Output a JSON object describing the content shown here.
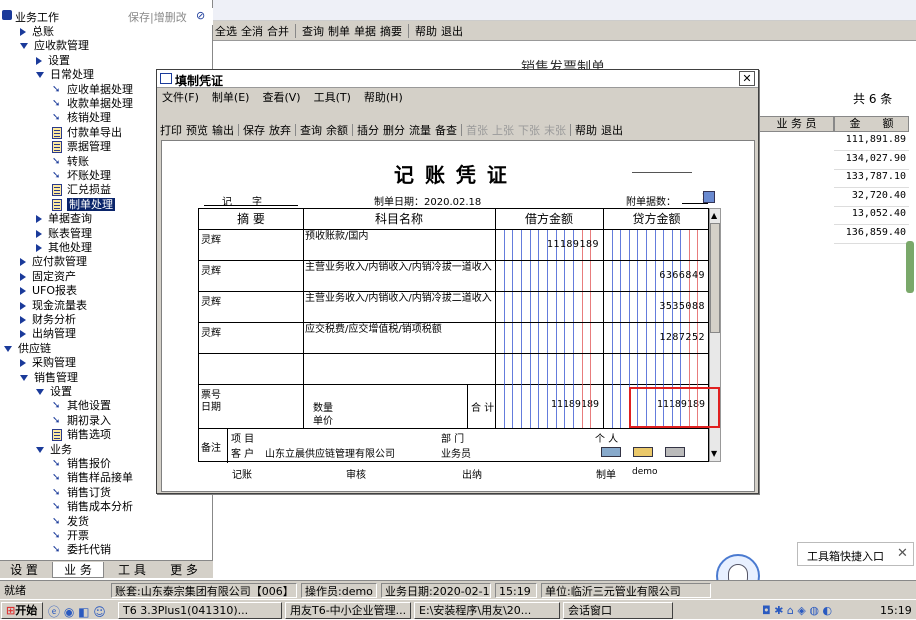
{
  "left_panel": {
    "title": "业务工作",
    "actions": "保存|增删改",
    "items": [
      {
        "label": "总账",
        "level": 1,
        "kind": "closed"
      },
      {
        "label": "应收款管理",
        "level": 1,
        "kind": "open"
      },
      {
        "label": "设置",
        "level": 2,
        "kind": "closed"
      },
      {
        "label": "日常处理",
        "level": 2,
        "kind": "open"
      },
      {
        "label": "应收单据处理",
        "level": 3,
        "kind": "arrow"
      },
      {
        "label": "收款单据处理",
        "level": 3,
        "kind": "arrow"
      },
      {
        "label": "核销处理",
        "level": 3,
        "kind": "arrow"
      },
      {
        "label": "付款单导出",
        "level": 3,
        "kind": "doc"
      },
      {
        "label": "票据管理",
        "level": 3,
        "kind": "doc"
      },
      {
        "label": "转账",
        "level": 3,
        "kind": "arrow"
      },
      {
        "label": "坏账处理",
        "level": 3,
        "kind": "arrow"
      },
      {
        "label": "汇兑损益",
        "level": 3,
        "kind": "doc"
      },
      {
        "label": "制单处理",
        "level": 3,
        "kind": "doc",
        "selected": true
      },
      {
        "label": "单据查询",
        "level": 2,
        "kind": "closed"
      },
      {
        "label": "账表管理",
        "level": 2,
        "kind": "closed"
      },
      {
        "label": "其他处理",
        "level": 2,
        "kind": "closed"
      },
      {
        "label": "应付款管理",
        "level": 1,
        "kind": "closed"
      },
      {
        "label": "固定资产",
        "level": 1,
        "kind": "closed"
      },
      {
        "label": "UFO报表",
        "level": 1,
        "kind": "closed"
      },
      {
        "label": "现金流量表",
        "level": 1,
        "kind": "closed"
      },
      {
        "label": "财务分析",
        "level": 1,
        "kind": "closed"
      },
      {
        "label": "出纳管理",
        "level": 1,
        "kind": "closed"
      },
      {
        "label": "供应链",
        "level": 0,
        "kind": "open"
      },
      {
        "label": "采购管理",
        "level": 1,
        "kind": "closed"
      },
      {
        "label": "销售管理",
        "level": 1,
        "kind": "open"
      },
      {
        "label": "设置",
        "level": 2,
        "kind": "open"
      },
      {
        "label": "其他设置",
        "level": 3,
        "kind": "arrow"
      },
      {
        "label": "期初录入",
        "level": 3,
        "kind": "arrow"
      },
      {
        "label": "销售选项",
        "level": 3,
        "kind": "doc"
      },
      {
        "label": "业务",
        "level": 2,
        "kind": "open"
      },
      {
        "label": "销售报价",
        "level": 3,
        "kind": "arrow"
      },
      {
        "label": "销售样品接单",
        "level": 3,
        "kind": "arrow"
      },
      {
        "label": "销售订货",
        "level": 3,
        "kind": "arrow"
      },
      {
        "label": "销售成本分析",
        "level": 3,
        "kind": "arrow"
      },
      {
        "label": "发货",
        "level": 3,
        "kind": "arrow"
      },
      {
        "label": "开票",
        "level": 3,
        "kind": "arrow"
      },
      {
        "label": "委托代销",
        "level": 3,
        "kind": "arrow"
      }
    ],
    "tabs": [
      "设 置",
      "业 务",
      "工 具",
      "更 多"
    ]
  },
  "main_toolbar": [
    "全选",
    "全消",
    "合并",
    "查询",
    "制单",
    "单据",
    "摘要",
    "帮助",
    "退出"
  ],
  "background_doc": {
    "title": "销售发票制单",
    "count_label": "共 6 条",
    "col_salesperson": "业 务 员",
    "col_amount": "金　　额",
    "amounts": [
      "111,891.89",
      "134,027.90",
      "133,787.10",
      "32,720.40",
      "13,052.40",
      "136,859.40"
    ]
  },
  "dialog": {
    "title": "填制凭证",
    "close": "✕",
    "menu": [
      "文件(F)",
      "制单(E)",
      "查看(V)",
      "工具(T)",
      "帮助(H)"
    ],
    "toolbar": [
      "打印",
      "预览",
      "输出",
      "保存",
      "放弃",
      "查询",
      "余额",
      "插分",
      "删分",
      "流量",
      "备查",
      "首张",
      "上张",
      "下张",
      "末张",
      "帮助",
      "退出"
    ],
    "toolbar_disabled": [
      "首张",
      "上张",
      "下张",
      "末张"
    ],
    "voucher": {
      "heading": "记 账 凭 证",
      "type_label": "记",
      "number_label": "字",
      "date_label": "制单日期：2020.02.18",
      "attach_label": "附单据数：",
      "attach_value": "1",
      "col_summary": "摘 要",
      "col_account": "科目名称",
      "col_debit": "借方金额",
      "col_credit": "贷方金额",
      "rows": [
        {
          "summary": "灵辉",
          "account": "预收账款/国内",
          "debit": "11189189",
          "credit": ""
        },
        {
          "summary": "灵辉",
          "account": "主营业务收入/内销收入/内销冷拔一道收入",
          "debit": "",
          "credit": "6366849"
        },
        {
          "summary": "灵辉",
          "account": "主营业务收入/内销收入/内销冷拔二道收入",
          "debit": "",
          "credit": "3535088"
        },
        {
          "summary": "灵辉",
          "account": "应交税费/应交增值税/销项税额",
          "debit": "",
          "credit": "1287252"
        },
        {
          "summary": "",
          "account": "",
          "debit": "",
          "credit": ""
        }
      ],
      "footer": {
        "ticket_no": "票号",
        "date": "日期",
        "qty": "数量",
        "unit_price": "单价",
        "total_label": "合 计",
        "total_debit": "11189189",
        "total_credit": "11189189"
      },
      "notes": {
        "remark": "备注",
        "project": "项 目",
        "dept": "部 门",
        "person": "个 人",
        "customer_label": "客 户",
        "customer": "山东立晨供应链管理有限公司",
        "salesman": "业务员"
      },
      "sign": {
        "bookkeeper": "记账",
        "reviewer": "审核",
        "cashier": "出纳",
        "maker": "制单",
        "maker_name": "demo"
      }
    }
  },
  "statusbar": {
    "ready": "就绪",
    "account": "账套:山东泰宗集团有限公司【006】",
    "operator": "操作员:demo",
    "biz_date": "业务日期:2020-02-18",
    "time": "15:19",
    "unit": "单位:临沂三元管业有限公司"
  },
  "toolbox_popup": "工具箱快捷入口",
  "taskbar": {
    "start": "开始",
    "tasks": [
      "T6 3.3Plus1(041310)...",
      "用友T6-中小企业管理...",
      "E:\\安装程序\\用友\\20...",
      "会话窗口"
    ],
    "clock": "15:19"
  },
  "colors": {
    "selection": "#0a246a",
    "highlight_box": "#e02020",
    "grid_red": "#e05050",
    "grid_blue": "#3050d0"
  }
}
